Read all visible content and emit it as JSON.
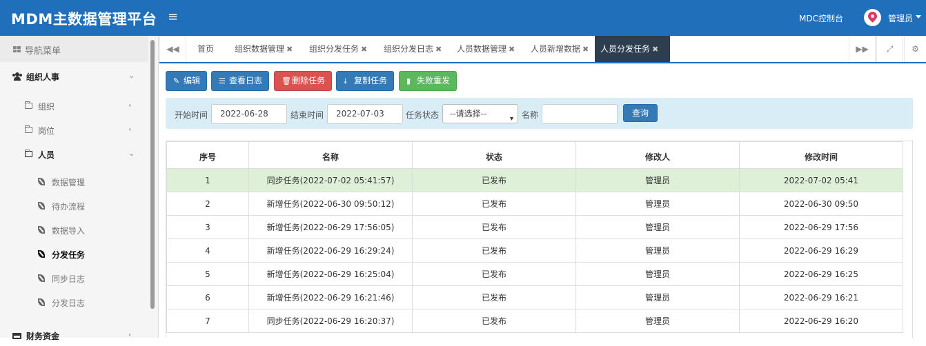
{
  "header": {
    "title": "MDM主数据管理平台",
    "menu_icon": "≡",
    "console_link": "MDC控制台",
    "user": "管理员"
  },
  "sidebar": {
    "heading": "导航菜单",
    "items": [
      {
        "label": "组织人事"
      },
      {
        "label": "组织"
      },
      {
        "label": "岗位"
      },
      {
        "label": "人员"
      },
      {
        "label": "数据管理"
      },
      {
        "label": "待办流程"
      },
      {
        "label": "数据导入"
      },
      {
        "label": "分发任务"
      },
      {
        "label": "同步日志"
      },
      {
        "label": "分发日志"
      },
      {
        "label": "财务资金"
      }
    ]
  },
  "tabs": [
    {
      "label": "首页"
    },
    {
      "label": "组织数据管理"
    },
    {
      "label": "组织分发任务"
    },
    {
      "label": "组织分发日志"
    },
    {
      "label": "人员数据管理"
    },
    {
      "label": "人员新增数据"
    },
    {
      "label": "人员分发任务"
    }
  ],
  "toolbar": {
    "edit": "编辑",
    "view_log": "查看日志",
    "delete_task": "删除任务",
    "copy_task": "复制任务",
    "resend_failed": "失败重发"
  },
  "search": {
    "start_label": "开始时间",
    "start_value": "2022-06-28",
    "end_label": "结束时间",
    "end_value": "2022-07-03",
    "status_label": "任务状态",
    "status_value": "--请选择--",
    "name_label": "名称",
    "name_value": "",
    "query_button": "查询"
  },
  "table": {
    "columns": [
      "序号",
      "名称",
      "状态",
      "修改人",
      "修改时间"
    ],
    "rows": [
      [
        "1",
        "同步任务(2022-07-02 05:41:57)",
        "已发布",
        "管理员",
        "2022-07-02 05:41"
      ],
      [
        "2",
        "新增任务(2022-06-30 09:50:12)",
        "已发布",
        "管理员",
        "2022-06-30 09:50"
      ],
      [
        "3",
        "新增任务(2022-06-29 17:56:05)",
        "已发布",
        "管理员",
        "2022-06-29 17:56"
      ],
      [
        "4",
        "新增任务(2022-06-29 16:29:24)",
        "已发布",
        "管理员",
        "2022-06-29 16:29"
      ],
      [
        "5",
        "新增任务(2022-06-29 16:25:04)",
        "已发布",
        "管理员",
        "2022-06-29 16:25"
      ],
      [
        "6",
        "新增任务(2022-06-29 16:21:46)",
        "已发布",
        "管理员",
        "2022-06-29 16:21"
      ],
      [
        "7",
        "同步任务(2022-06-29 16:20:37)",
        "已发布",
        "管理员",
        "2022-06-29 16:20"
      ]
    ]
  }
}
